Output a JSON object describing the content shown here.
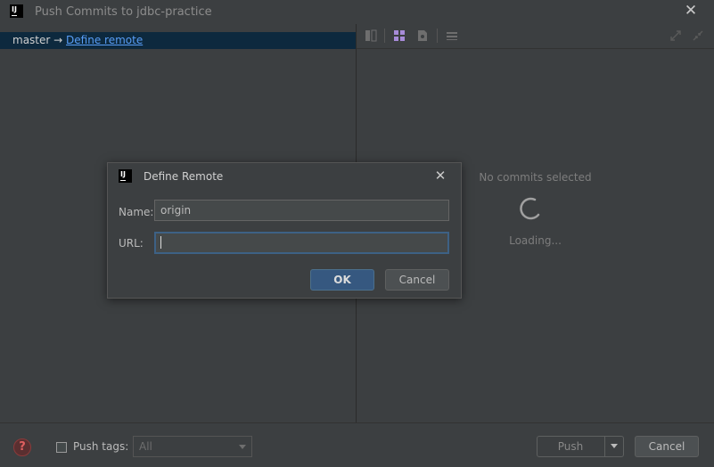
{
  "window": {
    "title": "Push Commits to jdbc-practice",
    "logo_text": "IJ",
    "close_icon": "close-icon"
  },
  "branch": {
    "source": "master",
    "arrow": "→",
    "target_link": "Define remote"
  },
  "right_panel": {
    "toolbar_icons": [
      "diff-icon",
      "grid-icon",
      "file-icon",
      "list-icon",
      "expand-icon",
      "collapse-icon"
    ],
    "empty_text": "No commits selected",
    "loading_text": "Loading..."
  },
  "bottom": {
    "help_icon": "help-icon",
    "push_tags_label": "Push tags:",
    "tags_value": "All",
    "push_label": "Push",
    "cancel_label": "Cancel"
  },
  "dialog": {
    "title": "Define Remote",
    "logo_text": "IJ",
    "name_label": "Name:",
    "name_value": "origin",
    "url_label": "URL:",
    "url_value": "",
    "ok_label": "OK",
    "cancel_label": "Cancel"
  },
  "colors": {
    "background": "#3c3f41",
    "selection": "#0d293e",
    "link": "#589df6",
    "primary_button": "#365880",
    "focus_border": "#3d6185"
  }
}
